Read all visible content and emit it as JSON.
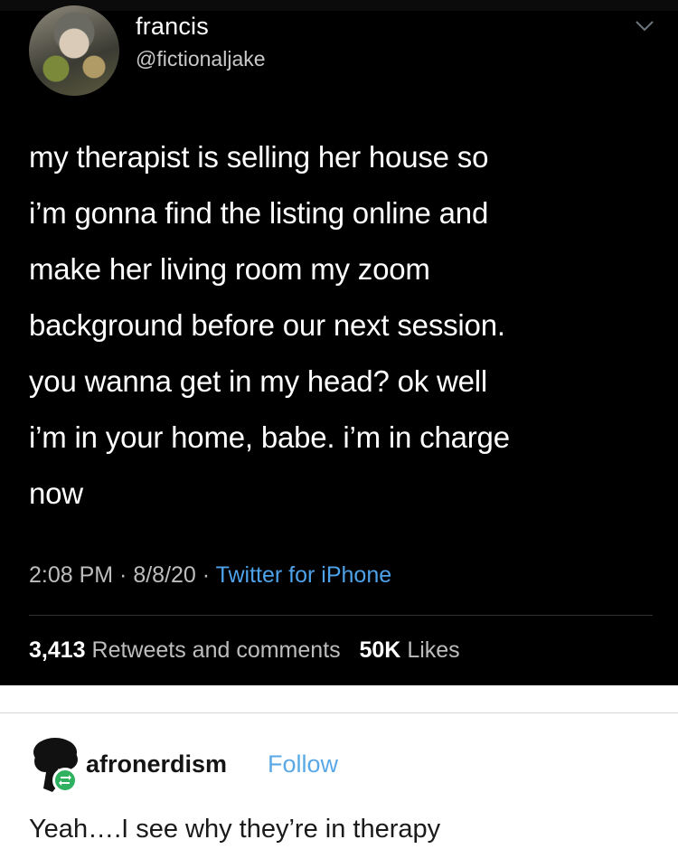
{
  "tweet": {
    "display_name": "francis",
    "handle": "@fictionaljake",
    "text_lines": [
      "my therapist is selling her house so",
      "i’m gonna find the listing online and",
      "make her living room my zoom",
      "background before our next session.",
      "you wanna get in my head? ok well",
      "i’m in your home, babe. i’m in charge",
      "now"
    ],
    "time": "2:08 PM",
    "date": "8/8/20",
    "source": "Twitter for iPhone",
    "separator": " · ",
    "retweets_count": "3,413",
    "retweets_label": "Retweets and comments",
    "likes_count": "50K",
    "likes_label": "Likes",
    "icons": {
      "avatar": "user-avatar-photo",
      "menu": "chevron-down-icon"
    },
    "colors": {
      "background": "#000000",
      "link": "#4da2ea",
      "muted": "#bdbdbd"
    }
  },
  "post": {
    "username": "afronerdism",
    "follow_label": "Follow",
    "comment": "Yeah….I see why they’re in therapy",
    "icons": {
      "avatar": "afro-silhouette-avatar",
      "badge": "reblog-icon"
    },
    "colors": {
      "follow": "#5aa9e6",
      "badge": "#2fb160"
    }
  }
}
